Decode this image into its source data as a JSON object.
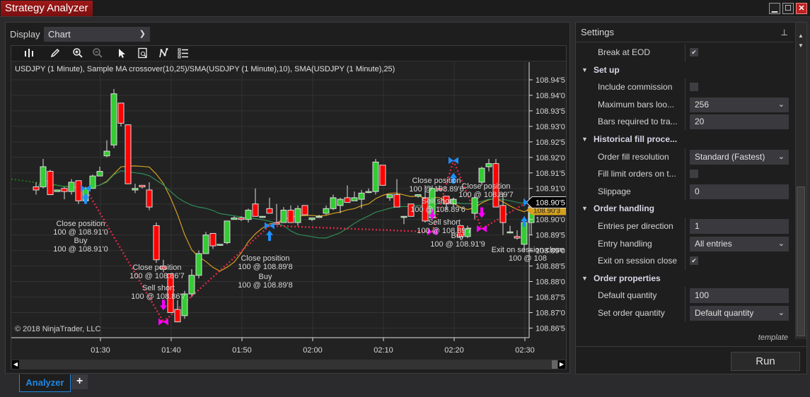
{
  "window": {
    "title": "Strategy Analyzer",
    "buttons": {
      "minimize": "minimize-icon",
      "maximize": "maximize-icon",
      "close": "close-icon"
    }
  },
  "display": {
    "label": "Display",
    "value": "Chart"
  },
  "toolbar": {
    "icons": [
      "bar-type-icon",
      "pencil-draw-icon",
      "zoom-in-icon",
      "zoom-out-icon",
      "pointer-icon",
      "data-box-icon",
      "strategies-icon",
      "properties-list-icon"
    ]
  },
  "chart": {
    "title": "USDJPY (1 Minute), Sample MA crossover(10,25)/SMA(USDJPY (1 Minute),10), SMA(USDJPY (1 Minute),25)",
    "copyright": "© 2018 NinjaTrader, LLC",
    "last_price_label": "108.90'5",
    "sma_label": "108.90'3"
  },
  "chart_data": {
    "type": "candlestick",
    "instrument": "USDJPY (1 Minute)",
    "x_ticks": [
      "01:30",
      "01:40",
      "01:50",
      "02:00",
      "02:10",
      "02:20",
      "02:30"
    ],
    "y_ticks": [
      "108.94'5",
      "108.94'0",
      "108.93'5",
      "108.93'0",
      "108.92'5",
      "108.92'0",
      "108.91'5",
      "108.91'0",
      "108.90'5",
      "108.90'0",
      "108.89'5",
      "108.89'0",
      "108.88'5",
      "108.88'0",
      "108.87'5",
      "108.87'0",
      "108.86'5"
    ],
    "y_range": [
      108.8635,
      108.9475
    ],
    "x_range_minutes": [
      "01:19",
      "02:31"
    ],
    "candles_start_time": "01:21",
    "candles": [
      [
        108.9105,
        108.912,
        108.908,
        108.9095
      ],
      [
        108.9105,
        108.9195,
        108.91,
        108.917
      ],
      [
        108.9155,
        108.916,
        108.908,
        108.908
      ],
      [
        108.909,
        108.9095,
        108.909,
        108.9095
      ],
      [
        108.91,
        108.9105,
        108.9065,
        108.909
      ],
      [
        108.909,
        108.913,
        108.908,
        108.912
      ],
      [
        108.9125,
        108.9125,
        108.905,
        108.906
      ],
      [
        108.906,
        108.9105,
        108.905,
        108.91
      ],
      [
        108.91,
        108.9145,
        108.91,
        108.914
      ],
      [
        108.914,
        108.917,
        108.914,
        108.9155
      ],
      [
        108.9205,
        108.9255,
        108.92,
        108.922
      ],
      [
        108.924,
        108.942,
        108.923,
        108.9405
      ],
      [
        108.9375,
        108.9375,
        108.93,
        108.931
      ],
      [
        108.9305,
        108.9305,
        108.9115,
        108.9115
      ],
      [
        108.9095,
        108.9115,
        108.9085,
        108.91
      ],
      [
        108.911,
        108.911,
        108.91,
        108.9105
      ],
      [
        108.9095,
        108.912,
        108.903,
        108.904
      ],
      [
        108.898,
        108.899,
        108.886,
        108.887
      ],
      [
        108.885,
        108.887,
        108.883,
        108.884
      ],
      [
        108.8825,
        108.8825,
        108.87,
        108.87
      ],
      [
        108.871,
        108.874,
        108.867,
        108.867
      ],
      [
        108.869,
        108.877,
        108.868,
        108.876
      ],
      [
        108.876,
        108.884,
        108.875,
        108.882
      ],
      [
        108.882,
        108.89,
        108.881,
        108.889
      ],
      [
        108.889,
        108.896,
        108.889,
        108.895
      ],
      [
        108.8955,
        108.8955,
        108.8905,
        108.8915
      ],
      [
        108.892,
        108.892,
        108.8915,
        108.892
      ],
      [
        108.8925,
        108.899,
        108.892,
        108.8995
      ],
      [
        108.9,
        108.901,
        108.9,
        108.9005
      ],
      [
        108.9005,
        108.901,
        108.8995,
        108.9
      ],
      [
        108.9,
        108.9035,
        108.899,
        108.903
      ],
      [
        108.905,
        108.91,
        108.9045,
        108.901
      ],
      [
        108.901,
        108.901,
        108.9005,
        108.901
      ],
      [
        108.9035,
        108.907,
        108.9035,
        108.902
      ],
      [
        108.899,
        108.905,
        108.8985,
        108.8985
      ],
      [
        108.899,
        108.904,
        108.899,
        108.903
      ],
      [
        108.903,
        108.9045,
        108.899,
        108.899
      ],
      [
        108.899,
        108.9045,
        108.898,
        108.9035
      ],
      [
        108.9045,
        108.9045,
        108.9015,
        108.9015
      ],
      [
        108.9,
        108.9005,
        108.8995,
        108.9005
      ],
      [
        108.901,
        108.9015,
        108.9005,
        108.901
      ],
      [
        108.902,
        108.9045,
        108.9015,
        108.9035
      ],
      [
        108.9035,
        108.908,
        108.903,
        108.907
      ],
      [
        108.9045,
        108.907,
        108.902,
        108.9065
      ],
      [
        108.907,
        108.911,
        108.9055,
        108.9055
      ],
      [
        108.906,
        108.909,
        108.906,
        108.907
      ],
      [
        108.9065,
        108.9095,
        108.9035,
        108.9085
      ],
      [
        108.909,
        108.91,
        108.9085,
        108.909
      ],
      [
        108.909,
        108.9195,
        108.908,
        108.9185
      ],
      [
        108.9175,
        108.9175,
        108.911,
        108.911
      ],
      [
        108.907,
        108.908,
        108.906,
        108.908
      ],
      [
        108.908,
        108.913,
        108.904,
        108.904
      ],
      [
        108.901,
        108.901,
        108.8985,
        108.901
      ],
      [
        108.905,
        108.905,
        108.901,
        108.901
      ],
      [
        108.9075,
        108.908,
        108.907,
        108.908
      ],
      [
        108.907,
        108.911,
        108.899,
        108.8995
      ],
      [
        108.9005,
        108.911,
        108.9,
        108.91
      ],
      [
        108.91,
        108.911,
        108.9095,
        108.9095
      ],
      [
        108.9075,
        108.9075,
        108.903,
        108.905
      ],
      [
        108.905,
        108.907,
        108.904,
        108.9065
      ],
      [
        108.898,
        108.898,
        108.8935,
        108.8945
      ],
      [
        108.8945,
        108.898,
        108.894,
        108.897
      ],
      [
        108.902,
        108.908,
        108.9,
        108.907
      ],
      [
        108.912,
        108.917,
        108.911,
        108.9165
      ],
      [
        108.917,
        108.9195,
        108.9155,
        108.918
      ],
      [
        108.918,
        108.9195,
        108.909,
        108.904
      ],
      [
        108.9045,
        108.9085,
        108.895,
        108.899
      ],
      [
        108.896,
        108.898,
        108.8955,
        108.896
      ],
      [
        108.8945,
        108.8965,
        108.8935,
        108.894
      ],
      [
        108.892,
        108.901,
        108.8895,
        108.899
      ],
      [
        108.899,
        108.906,
        108.895,
        108.904
      ],
      [
        108.904,
        108.9065,
        108.9035,
        108.905
      ],
      [
        108.906,
        108.906,
        108.9045,
        108.9045
      ],
      [
        108.903,
        108.906,
        108.9025,
        108.9055
      ]
    ],
    "series": [
      {
        "name": "SMA(USDJPY (1 Minute),10)",
        "color": "#d4a020"
      },
      {
        "name": "SMA(USDJPY (1 Minute),25)",
        "color": "#2e8b57"
      }
    ],
    "trades": [
      {
        "label": "Close position",
        "detail": "100 @ 108.91'0",
        "type": "exit"
      },
      {
        "label": "Buy",
        "detail": "100 @ 108.91'0",
        "type": "entry-long"
      },
      {
        "label": "Close position",
        "detail": "100 @ 108.86'7",
        "type": "exit"
      },
      {
        "label": "Sell short",
        "detail": "100 @ 108.86'7",
        "type": "entry-short"
      },
      {
        "label": "Close position",
        "detail": "100 @ 108.89'8",
        "type": "exit"
      },
      {
        "label": "Buy",
        "detail": "100 @ 108.89'8",
        "type": "entry-long"
      },
      {
        "label": "Close position",
        "detail": "100 @ 108.89'6",
        "type": "exit"
      },
      {
        "label": "Sell short",
        "detail": "100 @ 108.89'6",
        "type": "entry-short"
      },
      {
        "label": "Close position",
        "detail": "100 @ 108.89'7",
        "type": "exit"
      },
      {
        "label": "Sell short",
        "detail": "100 @ 108.89'7",
        "type": "entry-short"
      },
      {
        "label": "Buy",
        "detail": "100 @ 108.91'9",
        "type": "entry-long"
      },
      {
        "label": "Exit on session close",
        "detail": "100 @ 108",
        "type": "exit"
      }
    ],
    "grid": true,
    "colors": {
      "up": "#33cc33",
      "down": "#ff0000",
      "trade_line": "#dc2848",
      "long_arrow": "#1e90ff",
      "short_arrow": "#ff00ff"
    }
  },
  "settings": {
    "header": "Settings",
    "rows": [
      {
        "kind": "prop",
        "label": "Break at EOD",
        "type": "checkbox",
        "checked": true
      },
      {
        "kind": "category",
        "label": "Set up"
      },
      {
        "kind": "prop",
        "label": "Include commission",
        "type": "checkbox",
        "checked": false
      },
      {
        "kind": "prop",
        "label": "Maximum bars loo...",
        "type": "select",
        "value": "256"
      },
      {
        "kind": "prop",
        "label": "Bars required to tra...",
        "type": "text",
        "value": "20"
      },
      {
        "kind": "category",
        "label": "Historical fill proce..."
      },
      {
        "kind": "prop",
        "label": "Order fill resolution",
        "type": "select",
        "value": "Standard (Fastest)"
      },
      {
        "kind": "prop",
        "label": "Fill limit orders on t...",
        "type": "checkbox",
        "checked": false
      },
      {
        "kind": "prop",
        "label": "Slippage",
        "type": "text",
        "value": "0"
      },
      {
        "kind": "category",
        "label": "Order handling"
      },
      {
        "kind": "prop",
        "label": "Entries per direction",
        "type": "text",
        "value": "1"
      },
      {
        "kind": "prop",
        "label": "Entry handling",
        "type": "select",
        "value": "All entries"
      },
      {
        "kind": "prop",
        "label": "Exit on session close",
        "type": "checkbox",
        "checked": true
      },
      {
        "kind": "category",
        "label": "Order properties"
      },
      {
        "kind": "prop",
        "label": "Default quantity",
        "type": "text",
        "value": "100"
      },
      {
        "kind": "prop",
        "label": "Set order quantity",
        "type": "select",
        "value": "Default quantity"
      }
    ],
    "template_link": "template",
    "run_button": "Run"
  },
  "tabs": {
    "active": "Analyzer",
    "add": "+"
  }
}
